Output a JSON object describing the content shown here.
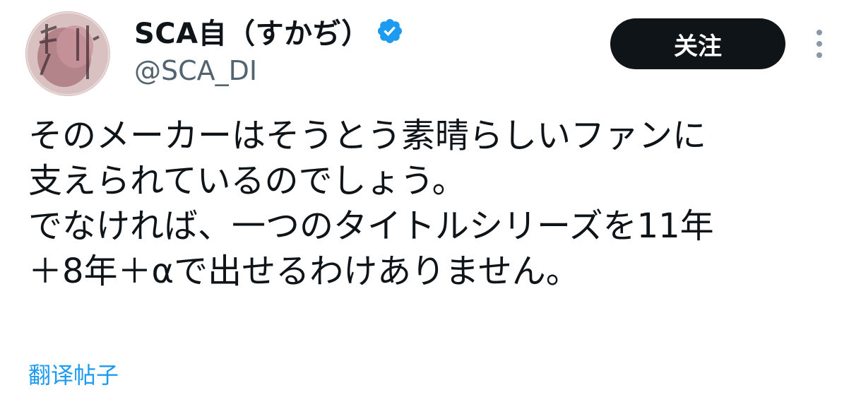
{
  "post": {
    "author": {
      "display_name": "SCA自（すかぢ）",
      "handle": "@SCA_DI",
      "verified": true,
      "avatar_icon": "avatar-image"
    },
    "follow_label": "关注",
    "more_icon": "more-vertical-icon",
    "text_lines": [
      "そのメーカーはそうとう素晴らしいファンに",
      "支えられているのでしょう。",
      "でなければ、一つのタイトルシリーズを11年",
      "＋8年＋αで出せるわけありません。"
    ],
    "translate_label": "翻译帖子"
  },
  "colors": {
    "verified_badge": "#1d9bf0",
    "follow_button_bg": "#0f1419",
    "link": "#1d9bf0",
    "secondary_text": "#536471"
  }
}
